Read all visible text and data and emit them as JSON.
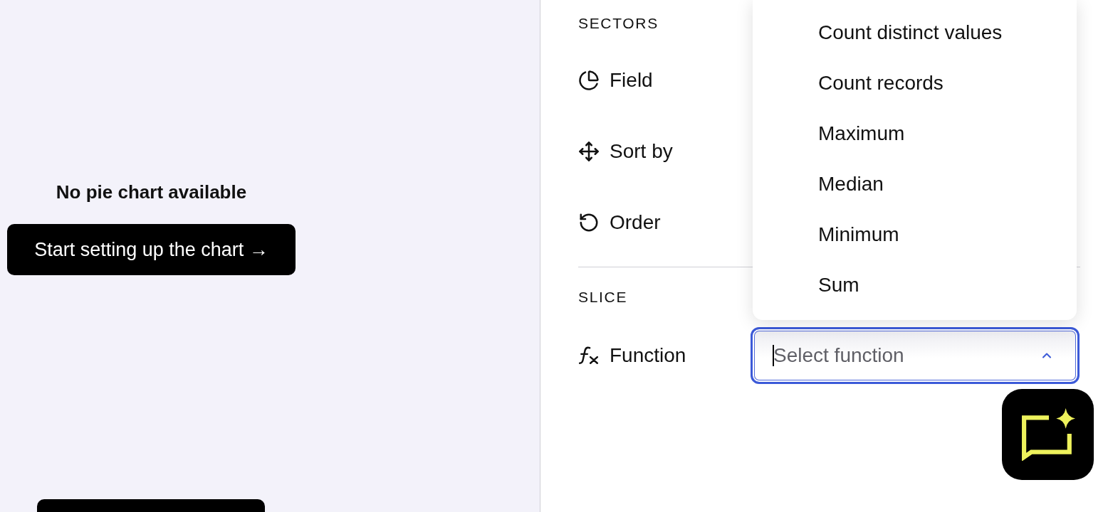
{
  "chart_area": {
    "title": "No pie chart available",
    "button": "Start setting up the chart →"
  },
  "sectors": {
    "heading": "SECTORS",
    "rows": [
      {
        "label": "Field"
      },
      {
        "label": "Sort by"
      },
      {
        "label": "Order"
      }
    ]
  },
  "slice": {
    "heading": "SLICE",
    "rows": [
      {
        "label": "Function",
        "select": {
          "placeholder": "Select function",
          "focused": true,
          "expanded": true,
          "options": [
            {
              "label": "Count distinct values",
              "selected": false
            },
            {
              "label": "Count records",
              "selected": false
            },
            {
              "label": "Maximum",
              "selected": false
            },
            {
              "label": "Median",
              "selected": false
            },
            {
              "label": "Minimum",
              "selected": false
            },
            {
              "label": "Sum",
              "selected": false
            }
          ]
        }
      }
    ]
  }
}
